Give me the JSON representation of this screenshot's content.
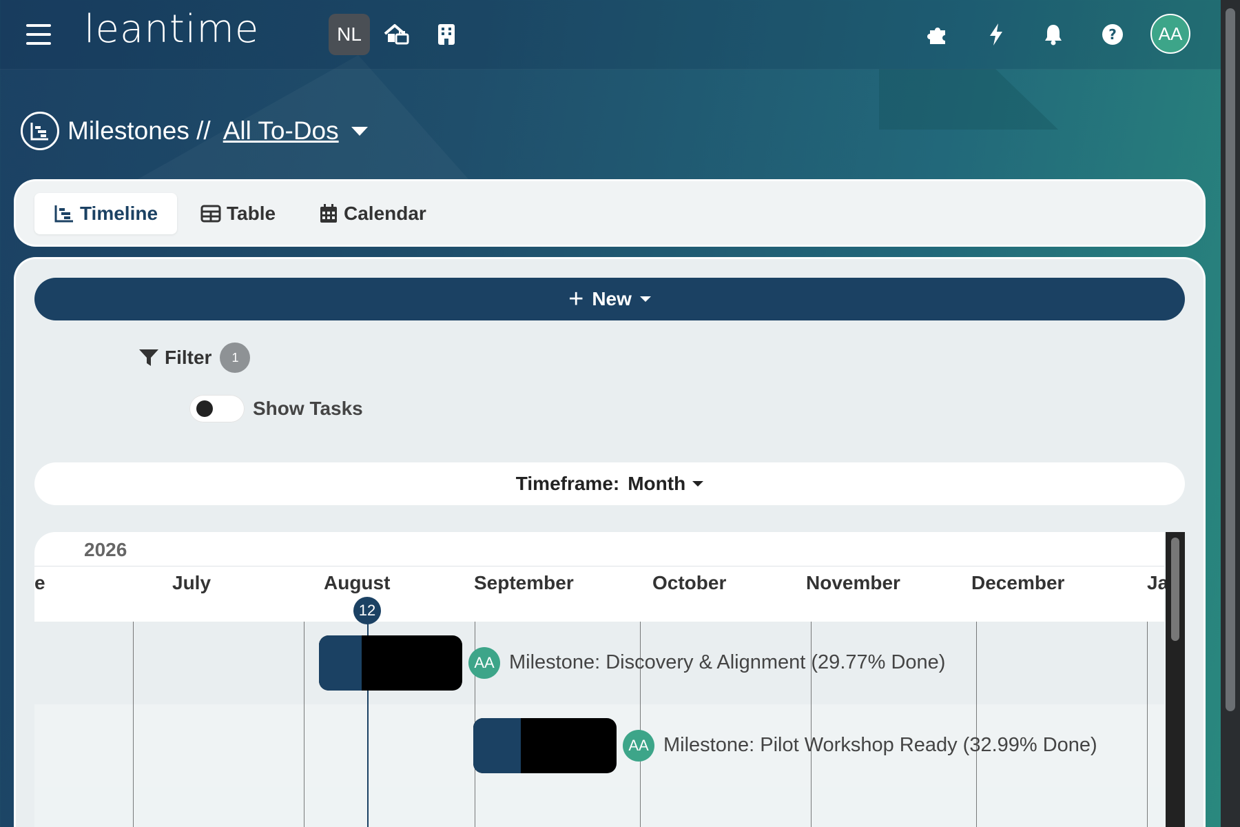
{
  "header": {
    "logo": "leantime",
    "workspace_badge": "NL",
    "user_initials": "AA",
    "icons": [
      "menu-icon",
      "home-briefcase-icon",
      "building-icon",
      "puzzle-icon",
      "bolt-icon",
      "bell-icon",
      "help-icon"
    ]
  },
  "breadcrumb": {
    "section": "Milestones //",
    "view": "All To-Dos "
  },
  "tabs": [
    {
      "label": "Timeline",
      "icon": "timeline-icon",
      "active": true
    },
    {
      "label": "Table",
      "icon": "table-icon",
      "active": false
    },
    {
      "label": "Calendar",
      "icon": "calendar-icon",
      "active": false
    }
  ],
  "toolbar": {
    "new_label": "New",
    "filter_label": "Filter",
    "filter_count": "1",
    "show_tasks_label": "Show Tasks",
    "timeframe_label": "Timeframe:",
    "timeframe_value": "Month"
  },
  "gantt": {
    "year": "2026",
    "months": [
      "e",
      "July",
      "August",
      "September",
      "October",
      "November",
      "December",
      "Ja"
    ],
    "today_day": "12",
    "milestones": [
      {
        "label": "Milestone: Discovery & Alignment (29.77% Done)",
        "owner": "AA",
        "progress": 0.2977
      },
      {
        "label": "Milestone: Pilot Workshop Ready (32.99% Done)",
        "owner": "AA",
        "progress": 0.3299
      }
    ]
  },
  "colors": {
    "primary": "#1b4163",
    "avatar": "#3da589",
    "bar": "#000000"
  }
}
